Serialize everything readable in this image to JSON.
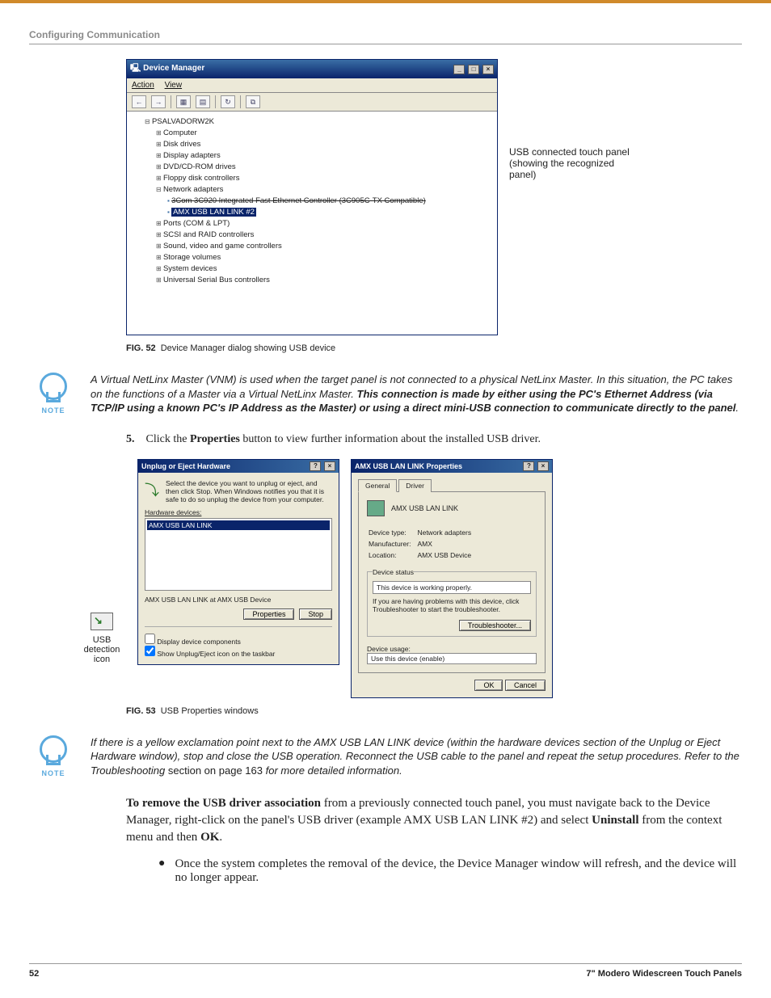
{
  "header": {
    "section": "Configuring Communication"
  },
  "fig52": {
    "windowTitle": "Device Manager",
    "menus": {
      "action": "Action",
      "view": "View"
    },
    "treeRoot": "PSALVADORW2K",
    "nodes": {
      "computer": "Computer",
      "disk": "Disk drives",
      "display": "Display adapters",
      "dvd": "DVD/CD-ROM drives",
      "floppy": "Floppy disk controllers",
      "network": "Network adapters",
      "nic_strike": "3Com 3C920 Integrated Fast Ethernet Controller (3C905C-TX Compatible)",
      "amx": "AMX USB LAN LINK #2",
      "ports": "Ports (COM & LPT)",
      "scsi": "SCSI and RAID controllers",
      "sound": "Sound, video and game controllers",
      "storage": "Storage volumes",
      "system": "System devices",
      "usb": "Universal Serial Bus controllers"
    },
    "callout": "USB connected touch panel (showing the recognized panel)",
    "captionNum": "FIG. 52",
    "captionText": "Device Manager dialog showing USB device"
  },
  "note1": {
    "label": "NOTE",
    "body_a": "A Virtual NetLinx Master (VNM) is used when the target panel is not connected to a physical NetLinx Master. In this situation, the PC takes on the functions of a Master via a Virtual NetLinx Master. ",
    "body_b": "This connection is made by either using the PC's Ethernet Address (via TCP/IP using a known PC's IP Address as the Master) or using a direct mini-USB connection to communicate directly to the panel",
    "body_c": "."
  },
  "step5": {
    "num": "5.",
    "pre": "Click the ",
    "bold": "Properties",
    "post": " button to view further information about the installed USB driver."
  },
  "fig53": {
    "usbdet": {
      "l1": "USB",
      "l2": "detection",
      "l3": "icon"
    },
    "unplug": {
      "title": "Unplug or Eject Hardware",
      "hint": "Select the device you want to unplug or eject, and then click Stop. When Windows notifies you that it is safe to do so unplug the device from your computer.",
      "hwlabel": "Hardware devices:",
      "selected": "AMX USB LAN LINK",
      "path": "AMX USB LAN LINK at AMX USB Device",
      "btnProps": "Properties",
      "btnStop": "Stop",
      "opt1": "Display device components",
      "opt2": "Show Unplug/Eject icon on the taskbar"
    },
    "props": {
      "title": "AMX USB LAN LINK Properties",
      "tabGeneral": "General",
      "tabDriver": "Driver",
      "dvcname": "AMX USB LAN LINK",
      "dtL": "Device type:",
      "dtV": "Network adapters",
      "mfL": "Manufacturer:",
      "mfV": "AMX",
      "locL": "Location:",
      "locV": "AMX USB Device",
      "statusLegend": "Device status",
      "statusText": "This device is working properly.",
      "troubleHint": "If you are having problems with this device, click Troubleshooter to start the troubleshooter.",
      "btnTrouble": "Troubleshooter...",
      "usageL": "Device usage:",
      "usageV": "Use this device (enable)",
      "btnOK": "OK",
      "btnCancel": "Cancel"
    },
    "captionNum": "FIG. 53",
    "captionText": "USB Properties windows"
  },
  "note2": {
    "label": "NOTE",
    "a": "If there is a yellow exclamation point next to the AMX USB LAN LINK device (within the hardware devices section of the Unplug or Eject Hardware window), stop and close the USB operation. Reconnect the USB cable to the panel and repeat the setup procedures. Refer to the Troubleshooting ",
    "b": "section on page 163",
    "c": " for more detailed information."
  },
  "para2": {
    "a": "To remove the USB driver association",
    "b": " from a previously connected touch panel, you must navigate back to the Device Manager, right-click on the panel's USB driver (example AMX USB LAN LINK #2) and select ",
    "c": "Uninstall",
    "d": " from the context menu and then ",
    "e": "OK",
    "f": "."
  },
  "bullet": {
    "text": "Once the system completes the removal of the device, the Device Manager window will refresh, and the device will no longer appear."
  },
  "footer": {
    "page": "52",
    "title": "7\" Modero Widescreen Touch Panels"
  }
}
